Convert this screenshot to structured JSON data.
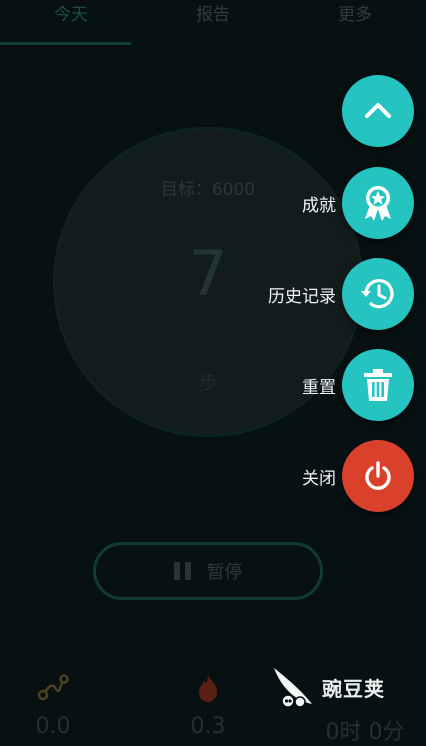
{
  "tabs": [
    {
      "label": "今天"
    },
    {
      "label": "报告"
    },
    {
      "label": "更多"
    }
  ],
  "counter": {
    "goal_text": "目标：6000",
    "steps": "7",
    "unit": "步"
  },
  "controls": {
    "pause_label": "暂停"
  },
  "stats": [
    {
      "icon": "route-icon",
      "value": "0.0"
    },
    {
      "icon": "flame-icon",
      "value": "0.3"
    },
    {
      "icon": "clock-icon",
      "value": "0时 0分"
    }
  ],
  "fab_menu": {
    "items": [
      {
        "label": "成就",
        "icon": "award-icon",
        "color": "#26c4c0"
      },
      {
        "label": "历史记录",
        "icon": "history-icon",
        "color": "#26c4c0"
      },
      {
        "label": "重置",
        "icon": "trash-icon",
        "color": "#26c4c0"
      },
      {
        "label": "关闭",
        "icon": "power-icon",
        "color": "#d9412a"
      }
    ],
    "toggle_icon": "chevron-up-icon"
  },
  "watermark": {
    "text": "豌豆荚"
  }
}
